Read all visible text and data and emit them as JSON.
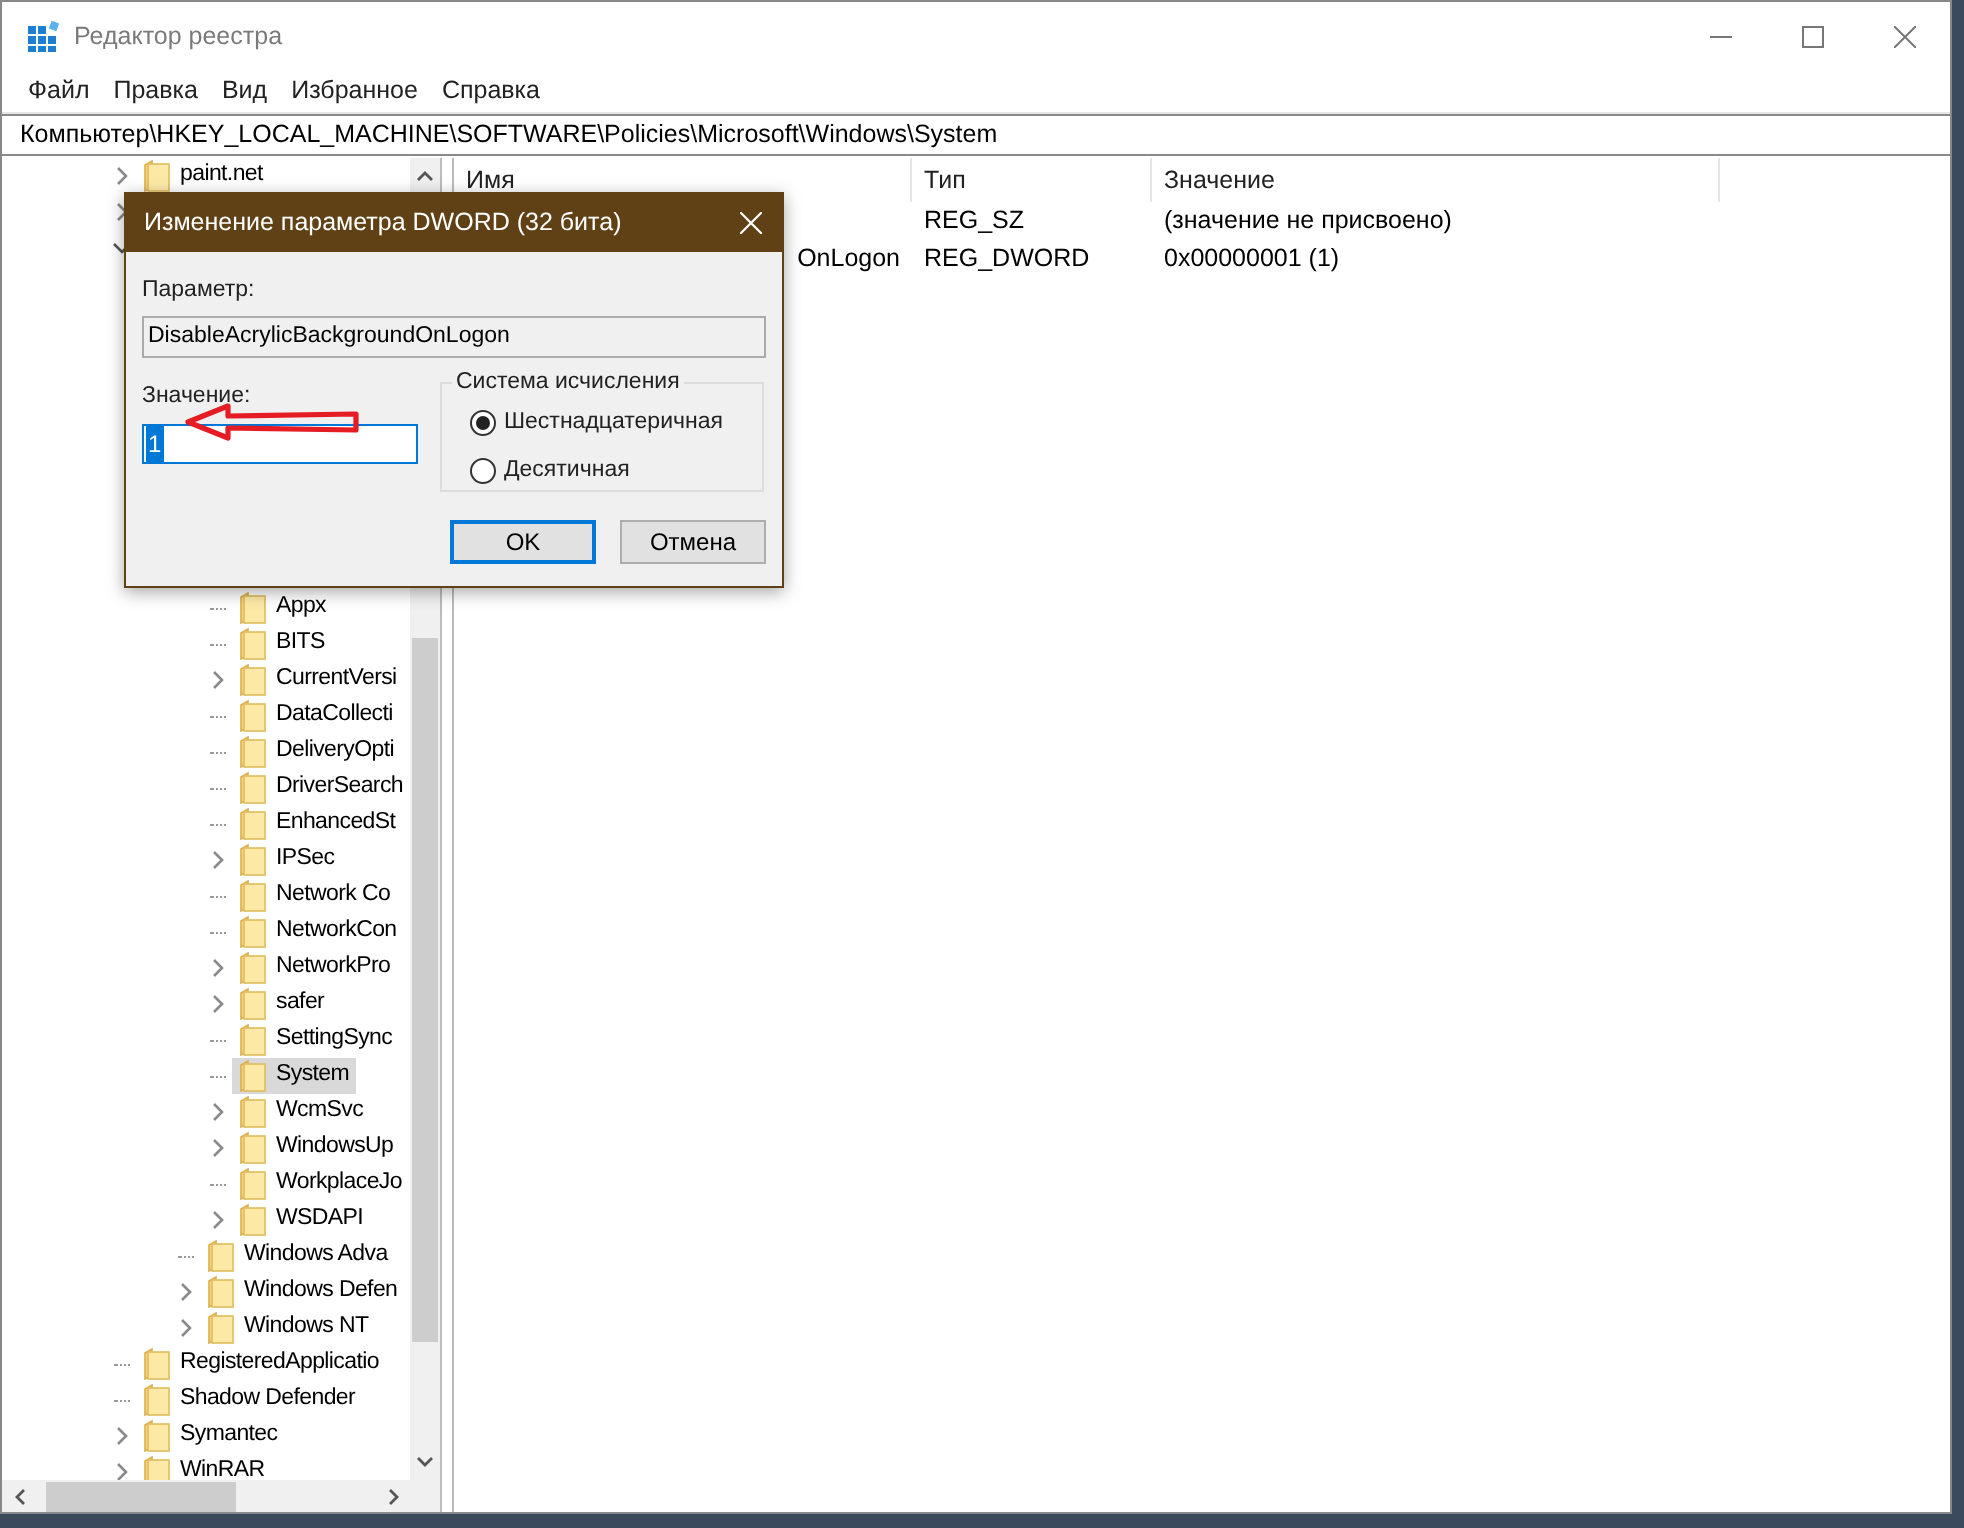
{
  "window": {
    "title": "Редактор реестра"
  },
  "menu": [
    "Файл",
    "Правка",
    "Вид",
    "Избранное",
    "Справка"
  ],
  "address": "Компьютер\\HKEY_LOCAL_MACHINE\\SOFTWARE\\Policies\\Microsoft\\Windows\\System",
  "tree": [
    {
      "label": "paint.net",
      "kind": "collapsed",
      "selected": false
    },
    {
      "kind": "collapsed"
    },
    {
      "kind": "expanded",
      "children": [
        {
          "children": [
            {
              "children": [
                {
                  "label": "Appx",
                  "kind": "leaf",
                  "selected": false
                },
                {
                  "label": "BITS",
                  "kind": "leaf",
                  "selected": false
                },
                {
                  "label": "CurrentVersi",
                  "kind": "collapsed",
                  "selected": false
                },
                {
                  "label": "DataCollecti",
                  "kind": "leaf",
                  "selected": false
                },
                {
                  "label": "DeliveryOpti",
                  "kind": "leaf",
                  "selected": false
                },
                {
                  "label": "DriverSearch",
                  "kind": "leaf",
                  "selected": false
                },
                {
                  "label": "EnhancedSt",
                  "kind": "leaf",
                  "selected": false
                },
                {
                  "label": "IPSec",
                  "kind": "collapsed",
                  "selected": false
                },
                {
                  "label": "Network Co",
                  "kind": "leaf",
                  "selected": false
                },
                {
                  "label": "NetworkCon",
                  "kind": "leaf",
                  "selected": false
                },
                {
                  "label": "NetworkPro",
                  "kind": "collapsed",
                  "selected": false
                },
                {
                  "label": "safer",
                  "kind": "collapsed",
                  "selected": false
                },
                {
                  "label": "SettingSync",
                  "kind": "leaf",
                  "selected": false
                },
                {
                  "label": "System",
                  "kind": "leaf",
                  "selected": true
                },
                {
                  "label": "WcmSvc",
                  "kind": "collapsed",
                  "selected": false
                },
                {
                  "label": "WindowsUp",
                  "kind": "collapsed",
                  "selected": false
                },
                {
                  "label": "WorkplaceJo",
                  "kind": "leaf",
                  "selected": false
                },
                {
                  "label": "WSDAPI",
                  "kind": "collapsed",
                  "selected": false
                }
              ]
            },
            {
              "label": "Windows Adva",
              "kind": "leaf",
              "selected": false
            },
            {
              "label": "Windows Defen",
              "kind": "collapsed",
              "selected": false
            },
            {
              "label": "Windows NT",
              "kind": "collapsed",
              "selected": false
            }
          ]
        }
      ]
    },
    {
      "label": "RegisteredApplicatio",
      "kind": "leaf",
      "selected": false
    },
    {
      "label": "Shadow Defender",
      "kind": "leaf",
      "selected": false
    },
    {
      "label": "Symantec",
      "kind": "collapsed",
      "selected": false
    },
    {
      "label": "WinRAR",
      "kind": "collapsed",
      "selected": false
    }
  ],
  "table": {
    "columns": [
      "Имя",
      "Тип",
      "Значение"
    ],
    "rows": [
      {
        "type": "REG_SZ",
        "value": "(значение не присвоено)"
      },
      {
        "name": "OnLogon",
        "type": "REG_DWORD",
        "value": "0x00000001 (1)"
      }
    ]
  },
  "dialog": {
    "title": "Изменение параметра DWORD (32 бита)",
    "param_label": "Параметр:",
    "param_value": "DisableAcrylicBackgroundOnLogon",
    "value_label": "Значение:",
    "value": "1",
    "base_legend": "Система исчисления",
    "bases": [
      {
        "label": "Шестнадцатеричная",
        "selected": true
      },
      {
        "label": "Десятичная",
        "selected": false
      }
    ],
    "buttons": [
      {
        "label": "OK",
        "kind": "default"
      },
      {
        "label": "Отмена",
        "kind": "normal"
      }
    ]
  }
}
